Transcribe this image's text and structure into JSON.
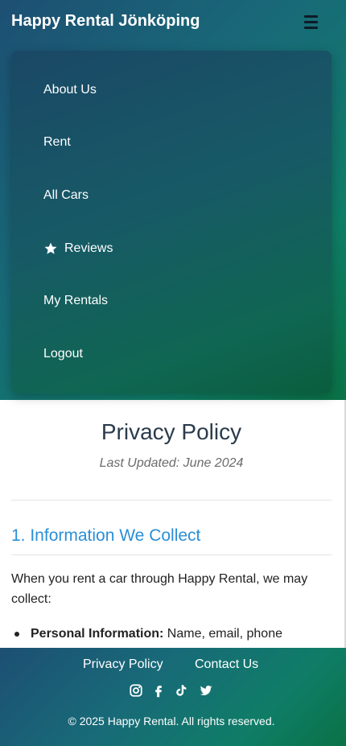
{
  "header": {
    "brand": "Happy Rental Jönköping",
    "menu_icon": "hamburger-icon"
  },
  "menu": {
    "items": [
      {
        "label": "About Us",
        "icon": null
      },
      {
        "label": "Rent",
        "icon": null
      },
      {
        "label": "All Cars",
        "icon": null
      },
      {
        "label": "Reviews",
        "icon": "star-icon"
      },
      {
        "label": "My Rentals",
        "icon": null
      },
      {
        "label": "Logout",
        "icon": null
      }
    ]
  },
  "main": {
    "title": "Privacy Policy",
    "last_updated": "Last Updated: June 2024",
    "section_title": "1. Information We Collect",
    "intro": "When you rent a car through Happy Rental, we may collect:",
    "bullets": [
      {
        "strong": "Personal Information:",
        "text": " Name, email, phone number, driver's license details"
      }
    ]
  },
  "footer": {
    "links": [
      "Privacy Policy",
      "Contact Us"
    ],
    "social": [
      "instagram-icon",
      "facebook-icon",
      "tiktok-icon",
      "twitter-icon"
    ],
    "copyright": "© 2025 Happy Rental. All rights reserved."
  },
  "colors": {
    "accent": "#2b8fd6",
    "gradient_start": "#1d4f73",
    "gradient_end": "#0a7246"
  }
}
